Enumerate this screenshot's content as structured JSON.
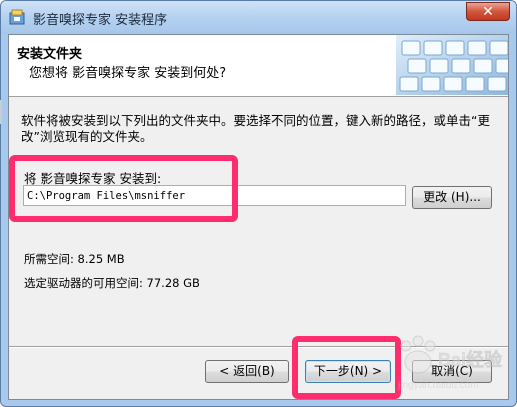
{
  "window": {
    "title": "影音嗅探专家 安装程序",
    "close_glyph": "✕"
  },
  "header": {
    "title": "安装文件夹",
    "subtitle": "您想将 影音嗅探专家 安装到何处?"
  },
  "body": {
    "instructions": "软件将被安装到以下列出的文件夹中。要选择不同的位置，键入新的路径，或单击“更改”浏览现有的文件夹。",
    "install_label": "将 影音嗅探专家 安装到:",
    "install_path": "C:\\Program Files\\msniffer",
    "browse_label": "更改 (H)...",
    "space_required": "所需空间: 8.25 MB",
    "space_available": "选定驱动器的可用空间: 77.28 GB"
  },
  "footer": {
    "back_label": "< 返回(B)",
    "next_label": "下一步(N) >",
    "cancel_label": "取消(C)"
  },
  "watermark": {
    "text": "Bai经验",
    "sub": "jingyan.baidu.com"
  },
  "colors": {
    "highlight": "#ff2d6e",
    "titlebar": "#b3d0f0",
    "close": "#c0391f"
  }
}
